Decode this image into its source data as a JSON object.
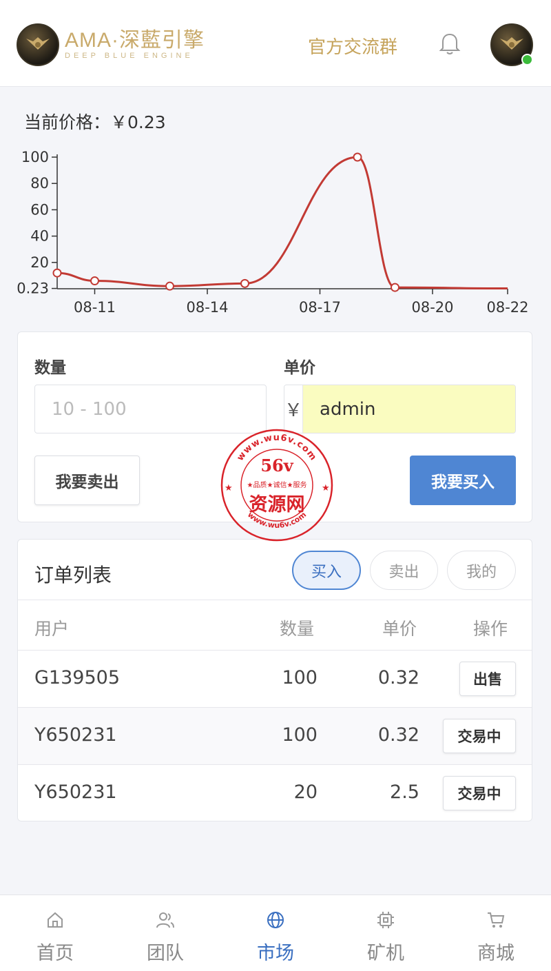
{
  "header": {
    "logo_title": "AMA·深藍引擎",
    "logo_subtitle": "DEEP BLUE ENGINE",
    "group_link": "官方交流群",
    "bell_icon": "bell-icon",
    "online_color": "#3bbb3b"
  },
  "price": {
    "label": "当前价格：",
    "value": "￥0.23"
  },
  "chart_data": {
    "type": "line",
    "title": "",
    "xlabel": "",
    "ylabel": "",
    "x": [
      "08-10",
      "08-11",
      "08-13",
      "08-15",
      "08-18",
      "08-19",
      "08-22"
    ],
    "series": [
      {
        "values": [
          12,
          6,
          2,
          4,
          100,
          1,
          0.23
        ]
      }
    ],
    "xticks": [
      "08-11",
      "08-14",
      "08-17",
      "08-20",
      "08-22"
    ],
    "yticks": [
      "0.23",
      "20",
      "40",
      "60",
      "80",
      "100"
    ],
    "ylim": [
      0,
      100
    ],
    "line_color": "#c23a34",
    "grid": false
  },
  "trade": {
    "quantity_label": "数量",
    "quantity_placeholder": "10 - 100",
    "price_label": "单价",
    "currency_symbol": "￥",
    "price_value": "admin",
    "sell_button": "我要卖出",
    "buy_button": "我要买入",
    "accent_color": "#4f86d3"
  },
  "orders": {
    "title": "订单列表",
    "tabs": [
      {
        "label": "买入",
        "active": true
      },
      {
        "label": "卖出",
        "active": false
      },
      {
        "label": "我的",
        "active": false
      }
    ],
    "columns": [
      "用户",
      "数量",
      "单价",
      "操作"
    ],
    "rows": [
      {
        "user": "G139505",
        "quantity": "100",
        "price": "0.32",
        "action": "出售"
      },
      {
        "user": "Y650231",
        "quantity": "100",
        "price": "0.32",
        "action": "交易中"
      },
      {
        "user": "Y650231",
        "quantity": "20",
        "price": "2.5",
        "action": "交易中"
      }
    ]
  },
  "watermark": {
    "url_top": "www.wu6v.com",
    "code": "56v",
    "slogan": "★品质★诚信★服务",
    "name": "资源网",
    "url_bottom": "www.wu6v.com",
    "color": "#d9232a"
  },
  "tabbar": {
    "items": [
      {
        "label": "首页",
        "icon": "home-icon",
        "active": false
      },
      {
        "label": "团队",
        "icon": "team-icon",
        "active": false
      },
      {
        "label": "市场",
        "icon": "globe-icon",
        "active": true
      },
      {
        "label": "矿机",
        "icon": "chip-icon",
        "active": false
      },
      {
        "label": "商城",
        "icon": "cart-icon",
        "active": false
      }
    ]
  }
}
